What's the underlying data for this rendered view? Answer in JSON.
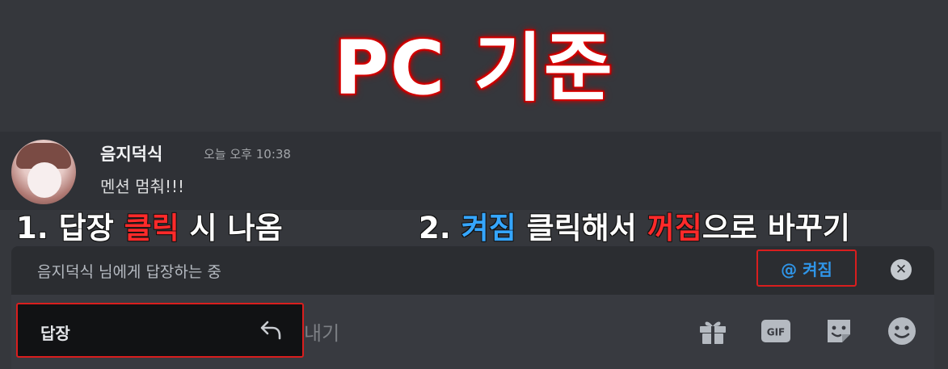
{
  "title": "PC 기준",
  "message": {
    "username": "음지덕식",
    "timestamp": "오늘 오후 10:38",
    "text": "멘션 멈춰!!!"
  },
  "annotations": {
    "step1_prefix": "1. 답장 ",
    "step1_highlight": "클릭",
    "step1_suffix": " 시 나옴",
    "step2_prefix": "2. ",
    "step2_blue": "켜짐",
    "step2_middle": " 클릭해서 ",
    "step2_red": "꺼짐",
    "step2_suffix": "으로 바꾸기"
  },
  "reply_bar": {
    "text": "음지덕식 님에게 답장하는 중",
    "mention_toggle": "@ 켜짐",
    "close_icon": "✕"
  },
  "input": {
    "placeholder_fragment": "내기"
  },
  "context_menu": {
    "label": "답장",
    "icon": "reply-arrow-icon"
  },
  "toolbar_icons": [
    "gift-icon",
    "gif-icon",
    "sticker-icon",
    "emoji-icon"
  ],
  "colors": {
    "highlight_red": "#d91e1e",
    "mention_blue": "#2f95e8"
  }
}
